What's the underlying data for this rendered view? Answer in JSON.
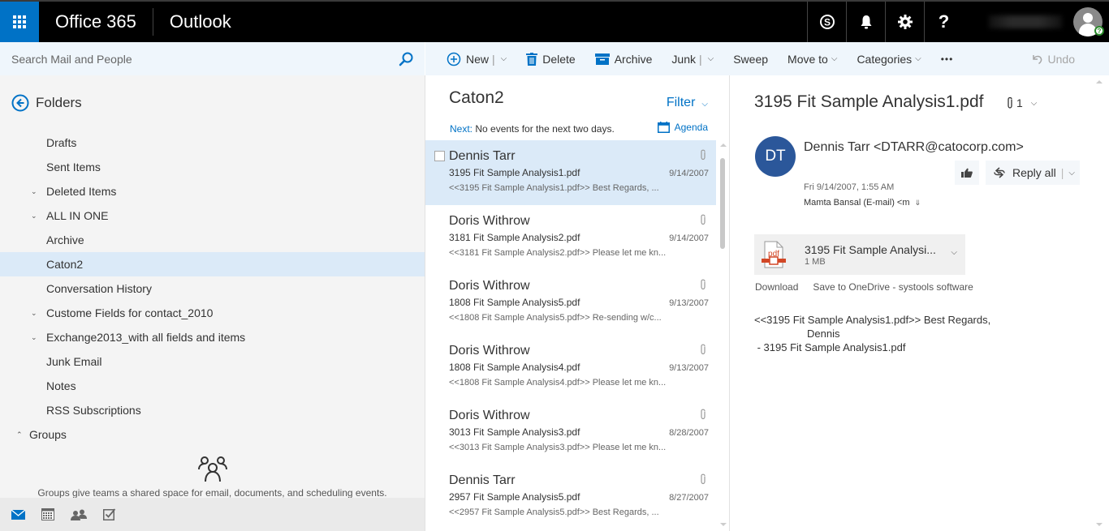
{
  "topbar": {
    "app_suite": "Office 365",
    "app_name": "Outlook",
    "icons": [
      "skype-icon",
      "bell-icon",
      "gear-icon",
      "help-icon"
    ],
    "help_label": "?",
    "presence_label": "?"
  },
  "search": {
    "placeholder": "Search Mail and People"
  },
  "toolbar": {
    "new_label": "New",
    "delete_label": "Delete",
    "archive_label": "Archive",
    "junk_label": "Junk",
    "sweep_label": "Sweep",
    "move_to_label": "Move to",
    "categories_label": "Categories",
    "more_label": "•••",
    "undo_label": "Undo",
    "separator": "|",
    "chevron": "⌵"
  },
  "folders": {
    "title": "Folders",
    "items": [
      {
        "label": "Drafts",
        "expandable": false,
        "selected": false
      },
      {
        "label": "Sent Items",
        "expandable": false,
        "selected": false
      },
      {
        "label": "Deleted Items",
        "expandable": true,
        "selected": false
      },
      {
        "label": "ALL IN ONE",
        "expandable": true,
        "selected": false
      },
      {
        "label": "Archive",
        "expandable": false,
        "selected": false
      },
      {
        "label": "Caton2",
        "expandable": false,
        "selected": true
      },
      {
        "label": "Conversation History",
        "expandable": false,
        "selected": false
      },
      {
        "label": "Custome Fields for contact_2010",
        "expandable": true,
        "selected": false
      },
      {
        "label": "Exchange2013_with all fields and items",
        "expandable": true,
        "selected": false
      },
      {
        "label": "Junk Email",
        "expandable": false,
        "selected": false
      },
      {
        "label": "Notes",
        "expandable": false,
        "selected": false
      },
      {
        "label": "RSS Subscriptions",
        "expandable": false,
        "selected": false
      }
    ],
    "groups_label": "Groups",
    "groups_empty_text": "Groups give teams a shared space for email, documents, and scheduling events.",
    "expand_glyph": "⌄",
    "collapse_glyph": "⌃"
  },
  "bottom_nav": {
    "items": [
      "mail-icon",
      "calendar-icon",
      "people-icon",
      "tasks-icon"
    ]
  },
  "message_list": {
    "folder_title": "Caton2",
    "filter_label": "Filter",
    "next_label": "Next:",
    "next_text": "No events for the next two days.",
    "agenda_label": "Agenda",
    "messages": [
      {
        "from": "Dennis Tarr",
        "subject": "3195 Fit Sample Analysis1.pdf",
        "date": "9/14/2007",
        "preview": "<<3195 Fit Sample Analysis1.pdf>> Best Regards,     ...",
        "has_attachment": true,
        "selected": true
      },
      {
        "from": "Doris Withrow",
        "subject": "3181 Fit Sample Analysis2.pdf",
        "date": "9/14/2007",
        "preview": "<<3181 Fit Sample Analysis2.pdf>> Please let me kn...",
        "has_attachment": true,
        "selected": false
      },
      {
        "from": "Doris Withrow",
        "subject": "1808 Fit Sample Analysis5.pdf",
        "date": "9/13/2007",
        "preview": "<<1808 Fit Sample Analysis5.pdf>> Re-sending w/c...",
        "has_attachment": true,
        "selected": false
      },
      {
        "from": "Doris Withrow",
        "subject": "1808 Fit Sample Analysis4.pdf",
        "date": "9/13/2007",
        "preview": "<<1808 Fit Sample Analysis4.pdf>> Please let me kn...",
        "has_attachment": true,
        "selected": false
      },
      {
        "from": "Doris Withrow",
        "subject": "3013 Fit Sample Analysis3.pdf",
        "date": "8/28/2007",
        "preview": "<<3013 Fit Sample Analysis3.pdf>> Please let me kn...",
        "has_attachment": true,
        "selected": false
      },
      {
        "from": "Dennis Tarr",
        "subject": "2957 Fit Sample Analysis5.pdf",
        "date": "8/27/2007",
        "preview": "<<2957 Fit Sample Analysis5.pdf>> Best Regards,     ...",
        "has_attachment": true,
        "selected": false
      }
    ]
  },
  "reading_pane": {
    "subject": "3195 Fit Sample Analysis1.pdf",
    "attachment_count": "1",
    "sender_initials": "DT",
    "sender": "Dennis Tarr <DTARR@catocorp.com>",
    "date": "Fri 9/14/2007, 1:55 AM",
    "to": "Mamta Bansal (E-mail) <m",
    "reply_all_label": "Reply all",
    "attachment": {
      "name": "3195 Fit Sample Analysi...",
      "size": "1 MB",
      "type_label": "pdf"
    },
    "download_label": "Download",
    "save_label": "Save to OneDrive - systools software",
    "body": "<<3195 Fit Sample Analysis1.pdf>> Best Regards,\n                  Dennis\n - 3195 Fit Sample Analysis1.pdf",
    "colors": {
      "avatar_bg": "#2b579a"
    }
  },
  "colors": {
    "accent": "#0072c6",
    "selected_bg": "#dbeaf8",
    "topbar_bg": "#000000",
    "toolbar_bg": "#eff6fc"
  }
}
